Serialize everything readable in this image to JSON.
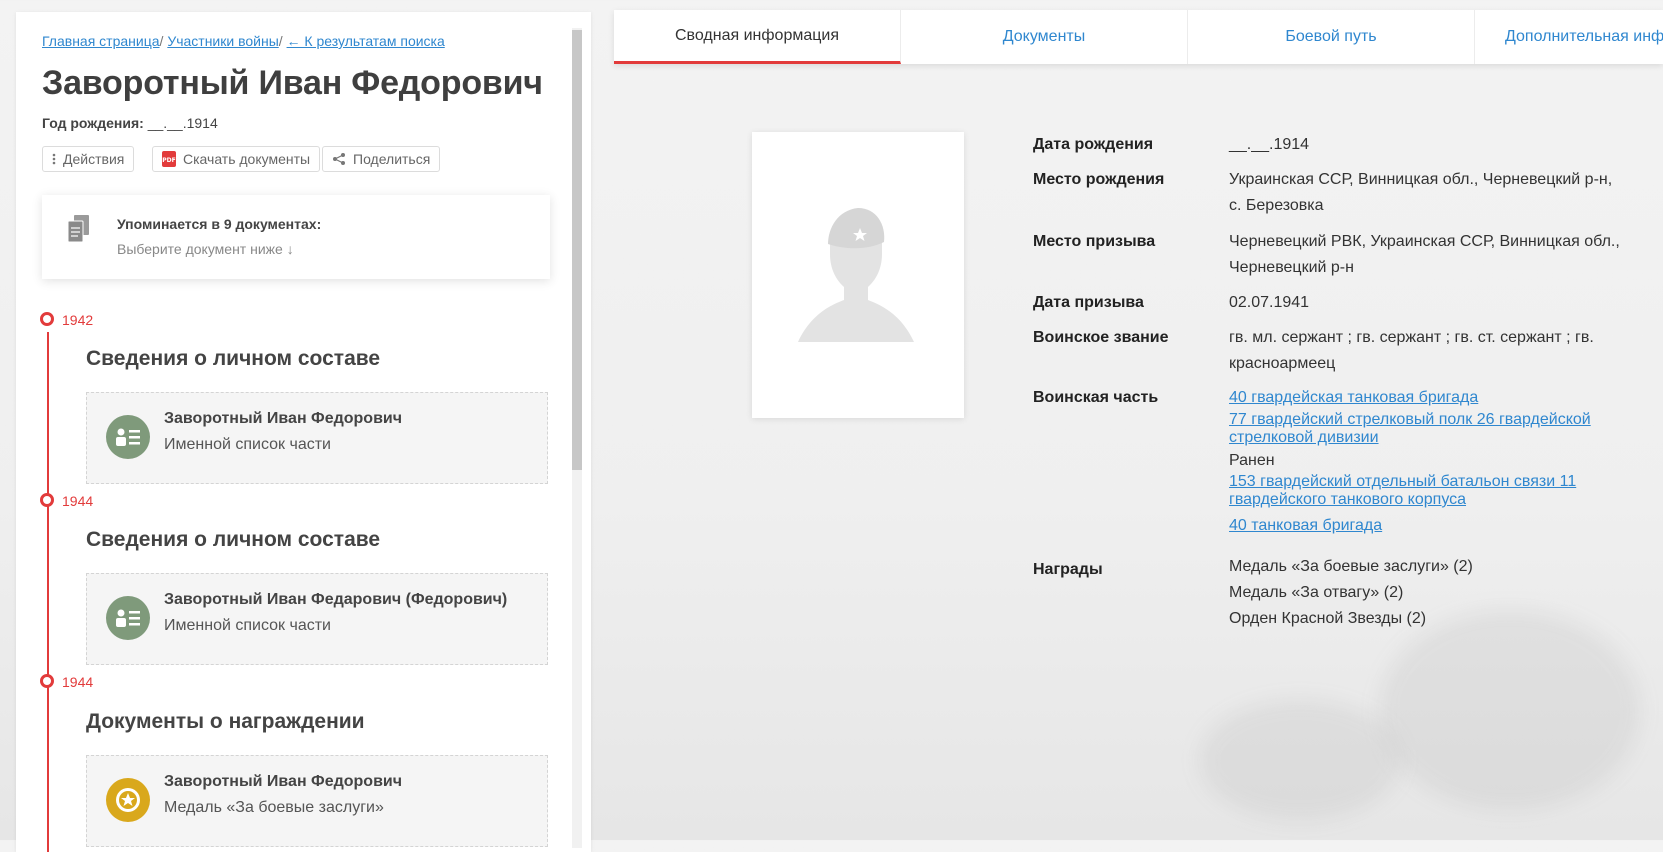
{
  "breadcrumb": {
    "home": "Главная страница",
    "participants": "Участники войны",
    "back": "← К результатам поиска",
    "separator": "/"
  },
  "person": {
    "name": "Заворотный Иван Федорович",
    "birth_year_label": "Год рождения:",
    "birth_year_value": "__.__.1914"
  },
  "actions": {
    "actions_label": "Действия",
    "download_label": "Скачать документы",
    "share_label": "Поделиться"
  },
  "mentions": {
    "title": "Упоминается в 9 документах:",
    "subtitle": "Выберите документ ниже ↓"
  },
  "timeline": [
    {
      "year": "1942",
      "heading": "Сведения о личном составе",
      "card_name": "Заворотный Иван Федорович",
      "card_sub": "Именной список части",
      "icon": "personnel-list-icon"
    },
    {
      "year": "1944",
      "heading": "Сведения о личном составе",
      "card_name": "Заворотный Иван Федарович (Федорович)",
      "card_sub": "Именной список части",
      "icon": "personnel-list-icon"
    },
    {
      "year": "1944",
      "heading": "Документы о награждении",
      "card_name": "Заворотный Иван Федорович",
      "card_sub": "Медаль «За боевые заслуги»",
      "icon": "medal-icon"
    }
  ],
  "tabs": [
    {
      "label": "Сводная информация",
      "active": true
    },
    {
      "label": "Документы",
      "active": false
    },
    {
      "label": "Боевой путь",
      "active": false
    },
    {
      "label": "Дополнительная информация",
      "active": false
    }
  ],
  "info": {
    "birth_date": {
      "label": "Дата рождения",
      "value": "__.__.1914"
    },
    "birth_place": {
      "label": "Место рождения",
      "value": "Украинская ССР, Винницкая обл., Черневецкий р-н, с. Березовка"
    },
    "draft_place": {
      "label": "Место призыва",
      "value": "Черневецкий РВК, Украинская ССР, Винницкая обл., Черневецкий р-н"
    },
    "draft_date": {
      "label": "Дата призыва",
      "value": "02.07.1941"
    },
    "rank": {
      "label": "Воинское звание",
      "value": "гв. мл. сержант ; гв. сержант ; гв. ст. сержант ; гв. красноармеец"
    },
    "unit": {
      "label": "Воинская часть",
      "links": [
        "40 гвардейская танковая бригада",
        "77 гвардейский стрелковый полк 26 гвардейской стрелковой дивизии"
      ],
      "status": "Ранен",
      "links_after": [
        "153 гвардейский отдельный батальон связи 11 гвардейского танкового корпуса",
        "40 танковая бригада"
      ]
    },
    "awards": {
      "label": "Награды",
      "items": [
        "Медаль «За боевые заслуги» (2)",
        "Медаль «За отвагу» (2)",
        "Орден Красной Звезды (2)"
      ]
    }
  },
  "colors": {
    "accent_red": "#e23b3b",
    "link_blue": "#2f87cf",
    "avatar_green": "#7f9a7b",
    "medal_gold": "#d9a81c"
  }
}
